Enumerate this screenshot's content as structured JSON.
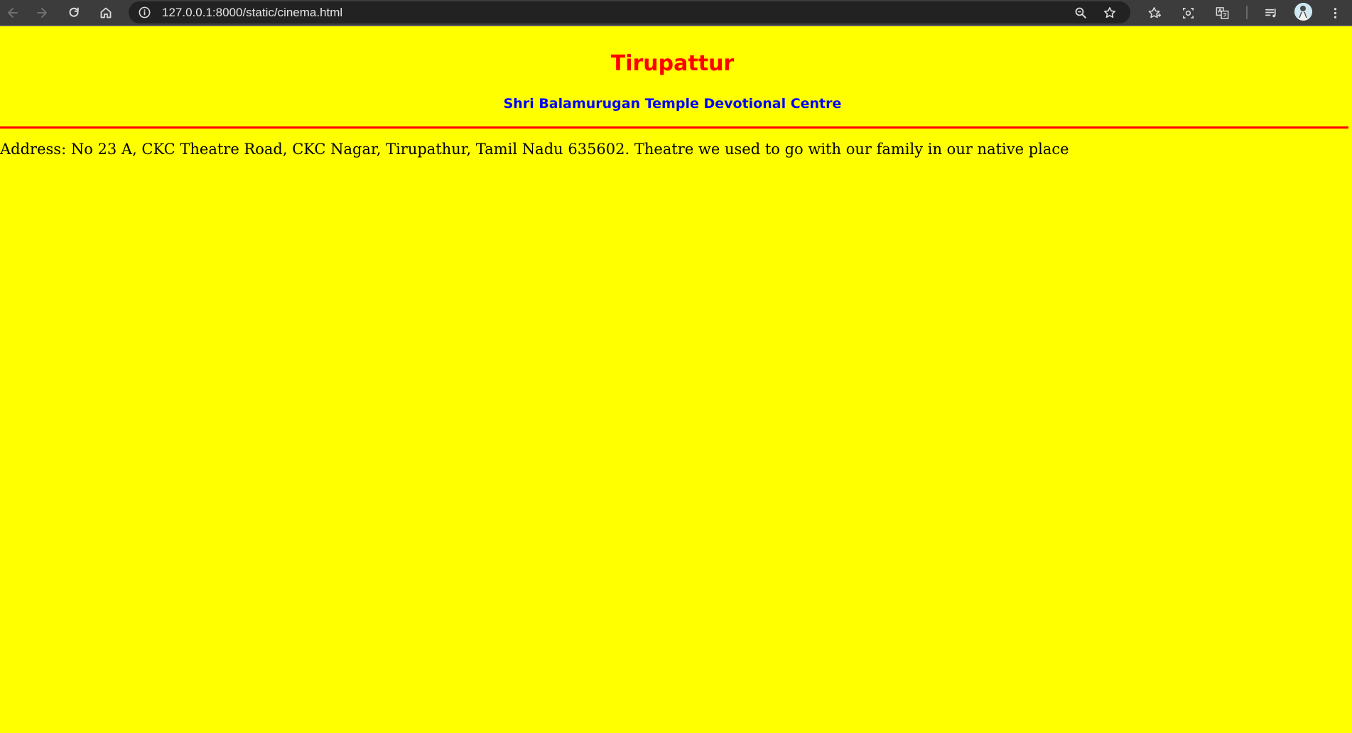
{
  "browser": {
    "url": "127.0.0.1:8000/static/cinema.html",
    "icons": [
      "back-arrow-icon",
      "forward-arrow-icon",
      "reload-icon",
      "home-icon",
      "site-info-icon",
      "zoom-icon",
      "bookmark-star-icon",
      "bookmarks-icon",
      "screenshot-icon",
      "translate-icon",
      "reading-list-icon",
      "profile-avatar",
      "menu-icon"
    ]
  },
  "page": {
    "title": "Tirupattur",
    "subtitle": "Shri Balamurugan Temple Devotional Centre",
    "address": "Address: No 23 A, CKC Theatre Road, CKC Nagar, Tirupathur, Tamil Nadu 635602. Theatre we used to go with our family in our native place"
  },
  "colors": {
    "background": "#ffff00",
    "title": "#ff0000",
    "subtitle": "#0000ff",
    "rule": "#ff0000",
    "text": "#000000",
    "toolbar": "#3c3c3c"
  }
}
